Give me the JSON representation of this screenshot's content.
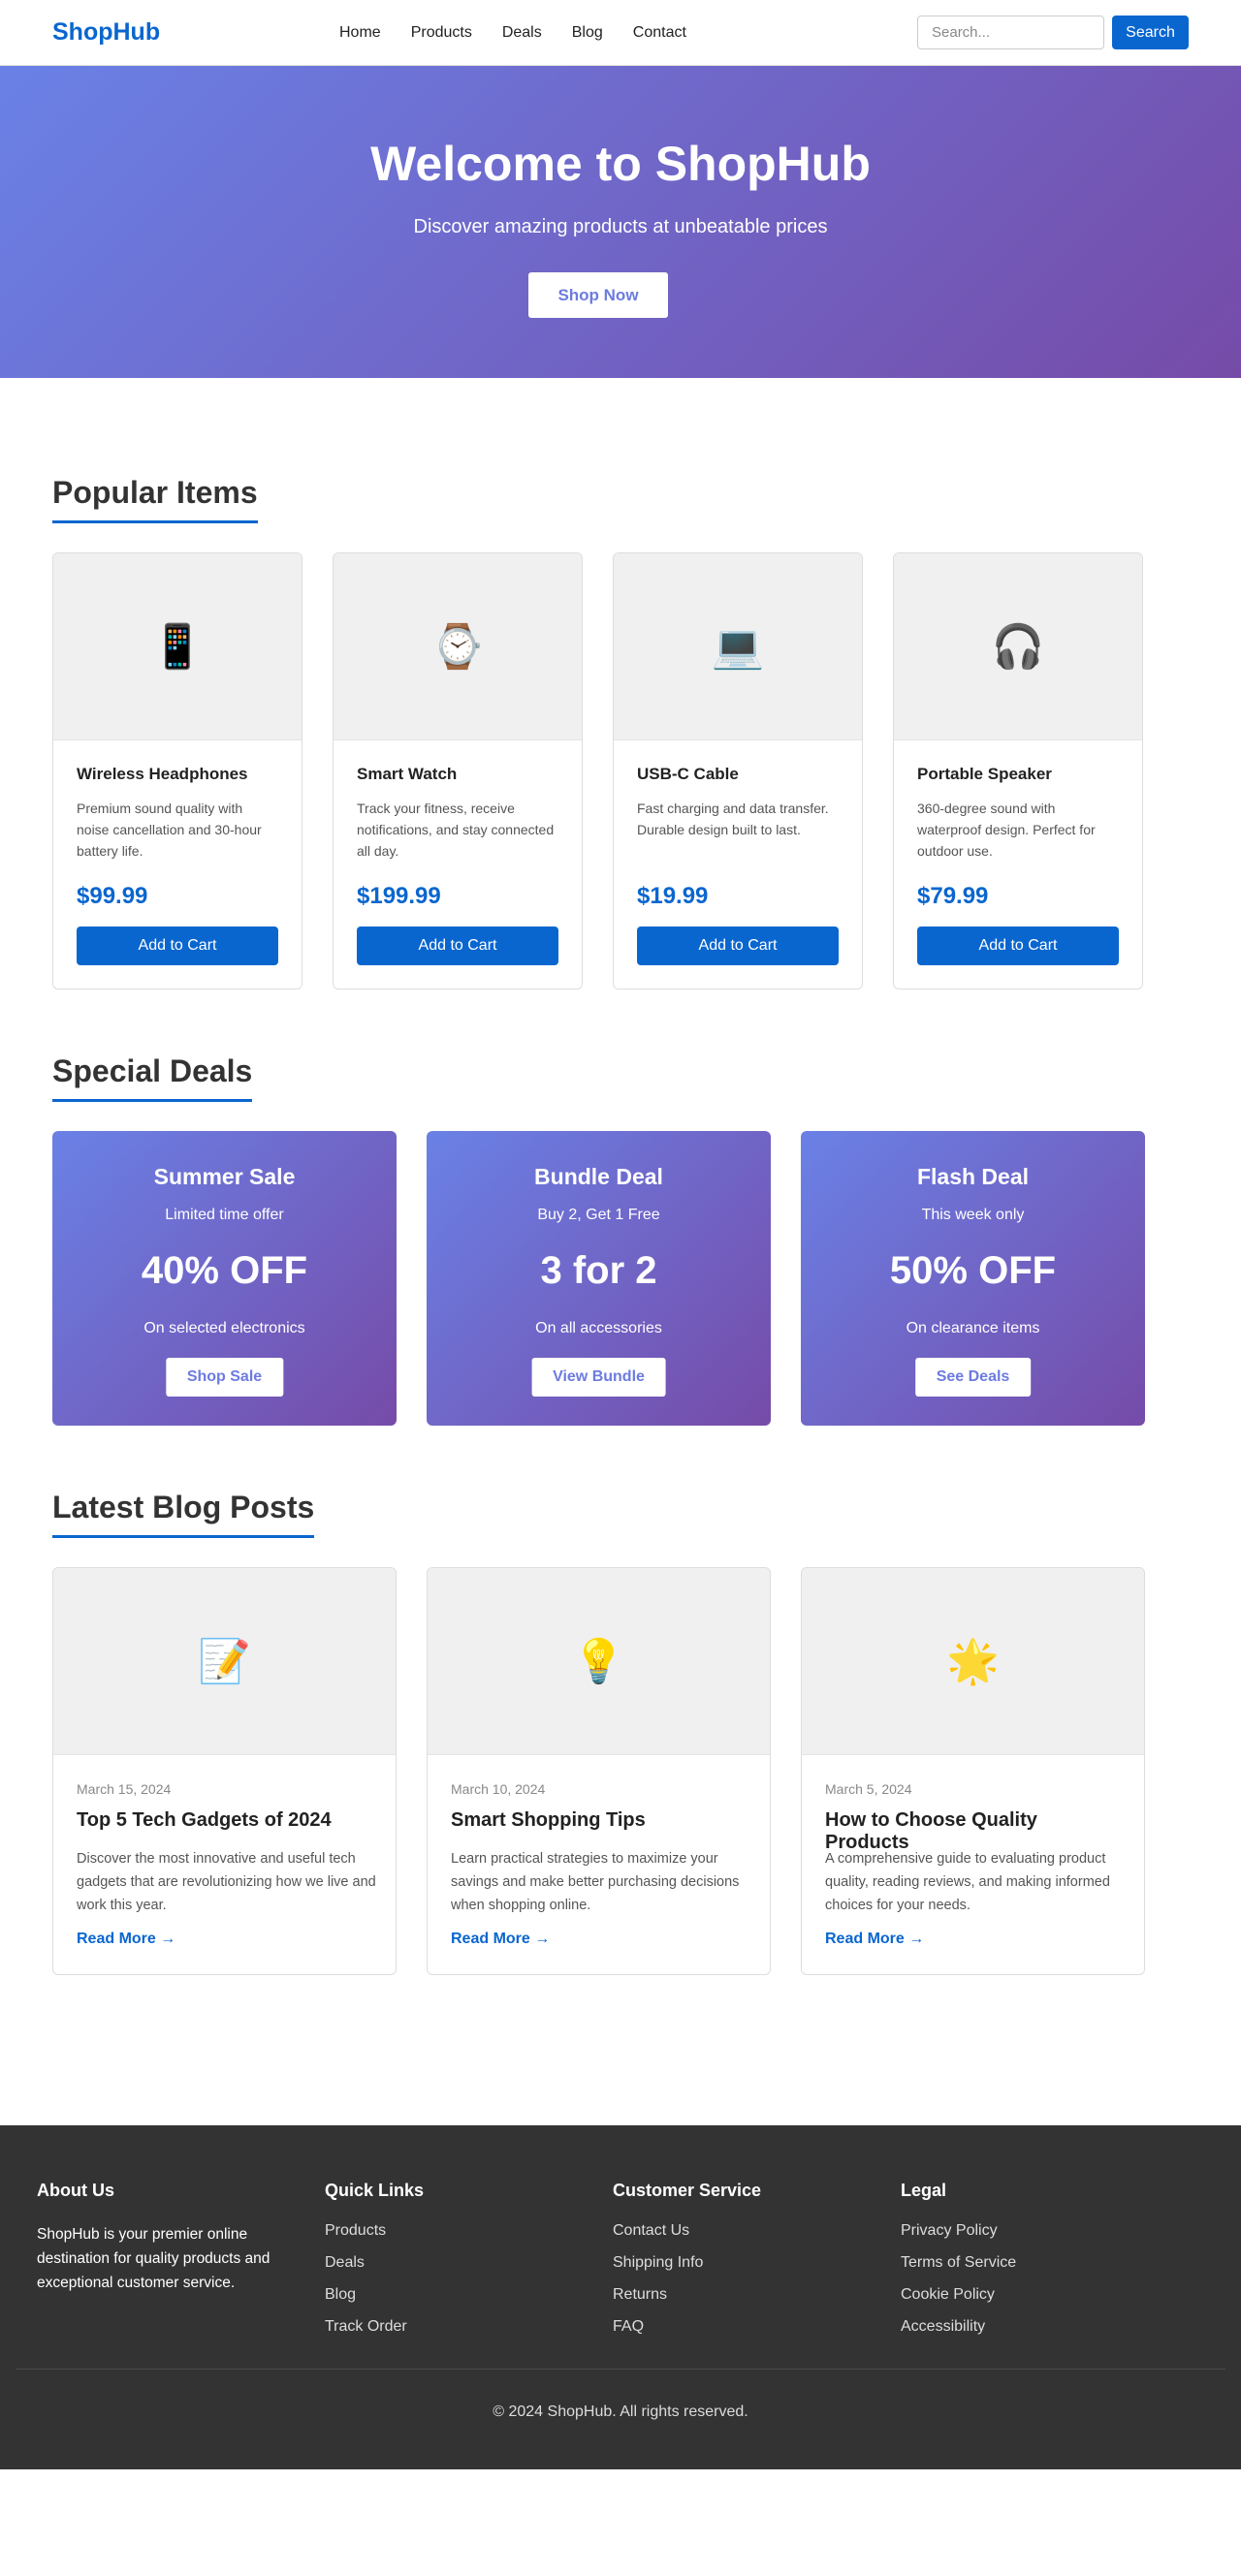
{
  "header": {
    "logo": "ShopHub",
    "nav": [
      "Home",
      "Products",
      "Deals",
      "Blog",
      "Contact"
    ],
    "search_placeholder": "Search...",
    "search_button": "Search",
    "accent_color": "#0a66cf"
  },
  "hero": {
    "title": "Welcome to ShopHub",
    "subtitle": "Discover amazing products at unbeatable prices",
    "cta": "Shop Now"
  },
  "popular": {
    "title": "Popular Items",
    "items": [
      {
        "icon": "📱",
        "icon_name": "mobile-phone-icon",
        "name": "Wireless Headphones",
        "desc": "Premium sound quality with noise cancellation and 30-hour battery life.",
        "price": "$99.99",
        "button": "Add to Cart"
      },
      {
        "icon": "⌚",
        "icon_name": "watch-icon",
        "name": "Smart Watch",
        "desc": "Track your fitness, receive notifications, and stay connected all day.",
        "price": "$199.99",
        "button": "Add to Cart"
      },
      {
        "icon": "💻",
        "icon_name": "laptop-icon",
        "name": "USB-C Cable",
        "desc": "Fast charging and data transfer. Durable design built to last.",
        "price": "$19.99",
        "button": "Add to Cart"
      },
      {
        "icon": "🎧",
        "icon_name": "headphones-icon",
        "name": "Portable Speaker",
        "desc": "360-degree sound with waterproof design. Perfect for outdoor use.",
        "price": "$79.99",
        "button": "Add to Cart"
      }
    ]
  },
  "deals": {
    "title": "Special Deals",
    "items": [
      {
        "title": "Summer Sale",
        "sub": "Limited time offer",
        "amount": "40% OFF",
        "note": "On selected electronics",
        "button": "Shop Sale"
      },
      {
        "title": "Bundle Deal",
        "sub": "Buy 2, Get 1 Free",
        "amount": "3 for 2",
        "note": "On all accessories",
        "button": "View Bundle"
      },
      {
        "title": "Flash Deal",
        "sub": "This week only",
        "amount": "50% OFF",
        "note": "On clearance items",
        "button": "See Deals"
      }
    ]
  },
  "blog": {
    "title": "Latest Blog Posts",
    "posts": [
      {
        "icon": "📝",
        "icon_name": "memo-icon",
        "date": "March 15, 2024",
        "title": "Top 5 Tech Gadgets of 2024",
        "excerpt": "Discover the most innovative and useful tech gadgets that are revolutionizing how we live and work this year.",
        "link": "Read More →"
      },
      {
        "icon": "💡",
        "icon_name": "light-bulb-icon",
        "date": "March 10, 2024",
        "title": "Smart Shopping Tips",
        "excerpt": "Learn practical strategies to maximize your savings and make better purchasing decisions when shopping online.",
        "link": "Read More →"
      },
      {
        "icon": "🌟",
        "icon_name": "star-icon",
        "date": "March 5, 2024",
        "title": "How to Choose Quality Products",
        "excerpt": "A comprehensive guide to evaluating product quality, reading reviews, and making informed choices for your needs.",
        "link": "Read More →"
      }
    ]
  },
  "footer": {
    "about_title": "About Us",
    "about_text": "ShopHub is your premier online destination for quality products and exceptional customer service.",
    "quick_title": "Quick Links",
    "quick_links": [
      "Products",
      "Deals",
      "Blog",
      "Track Order"
    ],
    "service_title": "Customer Service",
    "service_links": [
      "Contact Us",
      "Shipping Info",
      "Returns",
      "FAQ"
    ],
    "legal_title": "Legal",
    "legal_links": [
      "Privacy Policy",
      "Terms of Service",
      "Cookie Policy",
      "Accessibility"
    ],
    "copyright": "© 2024 ShopHub. All rights reserved."
  }
}
